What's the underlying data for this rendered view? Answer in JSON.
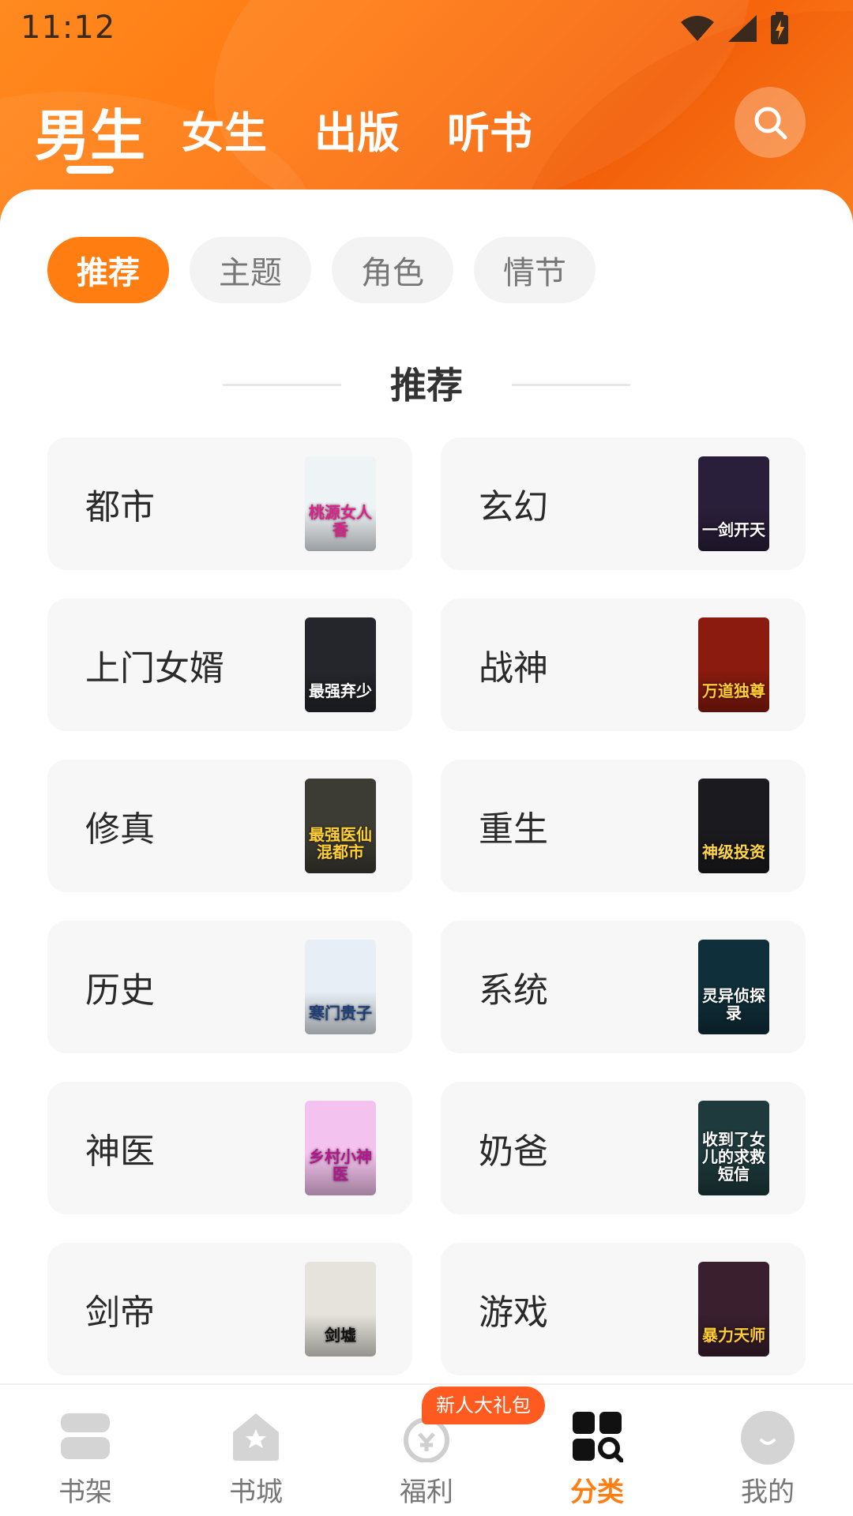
{
  "status_bar": {
    "time": "11:12"
  },
  "top_tabs": [
    {
      "label": "男生",
      "active": true
    },
    {
      "label": "女生",
      "active": false
    },
    {
      "label": "出版",
      "active": false
    },
    {
      "label": "听书",
      "active": false
    }
  ],
  "filter_chips": [
    {
      "label": "推荐",
      "active": true
    },
    {
      "label": "主题",
      "active": false
    },
    {
      "label": "角色",
      "active": false
    },
    {
      "label": "情节",
      "active": false
    }
  ],
  "section": {
    "title": "推荐"
  },
  "categories": [
    {
      "label": "都市",
      "cover_text": "桃源女人香",
      "cover_color": "#eef3f6",
      "cover_text_color": "#e0208a"
    },
    {
      "label": "玄幻",
      "cover_text": "一剑开天",
      "cover_color": "#2a1f3a",
      "cover_text_color": "#ffffff"
    },
    {
      "label": "上门女婿",
      "cover_text": "最强弃少",
      "cover_color": "#25262b",
      "cover_text_color": "#ffffff"
    },
    {
      "label": "战神",
      "cover_text": "万道独尊",
      "cover_color": "#8a1b0e",
      "cover_text_color": "#ffcc33"
    },
    {
      "label": "修真",
      "cover_text": "最强医仙混都市",
      "cover_color": "#3c3b34",
      "cover_text_color": "#ffcf33"
    },
    {
      "label": "重生",
      "cover_text": "神级投资",
      "cover_color": "#1b1b1f",
      "cover_text_color": "#ffd54a"
    },
    {
      "label": "历史",
      "cover_text": "寒门贵子",
      "cover_color": "#e7eef5",
      "cover_text_color": "#1d3f7a"
    },
    {
      "label": "系统",
      "cover_text": "灵异侦探录",
      "cover_color": "#0f2f3a",
      "cover_text_color": "#ffffff"
    },
    {
      "label": "神医",
      "cover_text": "乡村小神医",
      "cover_color": "#f4c2ee",
      "cover_text_color": "#b5168f"
    },
    {
      "label": "奶爸",
      "cover_text": "收到了女儿的求救短信",
      "cover_color": "#1e3a3c",
      "cover_text_color": "#ffffff"
    },
    {
      "label": "剑帝",
      "cover_text": "剑墟",
      "cover_color": "#e6e3dc",
      "cover_text_color": "#111111"
    },
    {
      "label": "游戏",
      "cover_text": "暴力天师",
      "cover_color": "#3a1f2e",
      "cover_text_color": "#ffcc33"
    }
  ],
  "bottom_nav": [
    {
      "label": "书架",
      "icon": "bookshelf-icon",
      "active": false
    },
    {
      "label": "书城",
      "icon": "store-star-icon",
      "active": false
    },
    {
      "label": "福利",
      "icon": "bonus-coin-icon",
      "active": false
    },
    {
      "label": "分类",
      "icon": "category-grid-icon",
      "active": true
    },
    {
      "label": "我的",
      "icon": "profile-icon",
      "active": false
    }
  ],
  "promo_badge": "新人大礼包",
  "colors": {
    "accent": "#ff7d11",
    "header": "#ff7a12",
    "card_bg": "#f7f7f7"
  }
}
